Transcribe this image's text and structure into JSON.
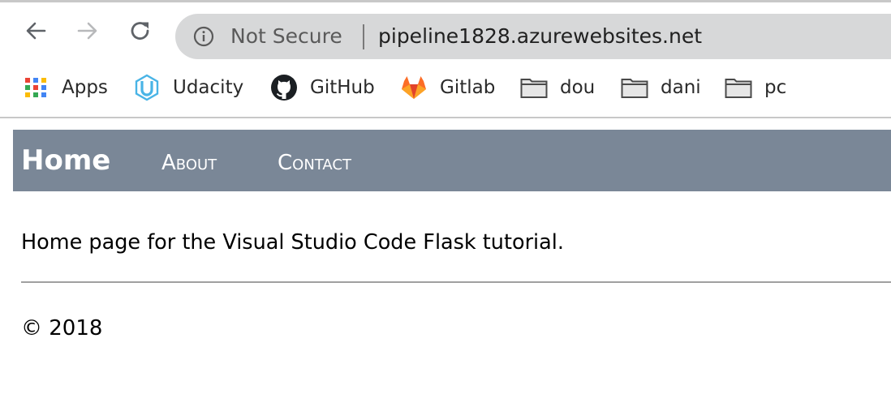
{
  "browser": {
    "security_label": "Not Secure",
    "url": "pipeline1828.azurewebsites.net",
    "nav_icons": {
      "back": "arrow-left-icon",
      "forward": "arrow-right-icon",
      "reload": "reload-icon",
      "security": "info-icon"
    },
    "bookmarks": [
      {
        "label": "Apps",
        "icon": "apps-grid-icon"
      },
      {
        "label": "Udacity",
        "icon": "udacity-logo-icon"
      },
      {
        "label": "GitHub",
        "icon": "github-logo-icon"
      },
      {
        "label": "Gitlab",
        "icon": "gitlab-logo-icon"
      },
      {
        "label": "dou",
        "icon": "folder-icon"
      },
      {
        "label": "dani",
        "icon": "folder-icon"
      },
      {
        "label": "pc",
        "icon": "folder-icon"
      }
    ]
  },
  "page": {
    "navbar": {
      "home_label": "Home",
      "links": [
        {
          "label": "About"
        },
        {
          "label": "Contact"
        }
      ],
      "background": "#7a8797"
    },
    "body_text": "Home page for the Visual Studio Code Flask tutorial.",
    "footer_text": "© 2018"
  }
}
